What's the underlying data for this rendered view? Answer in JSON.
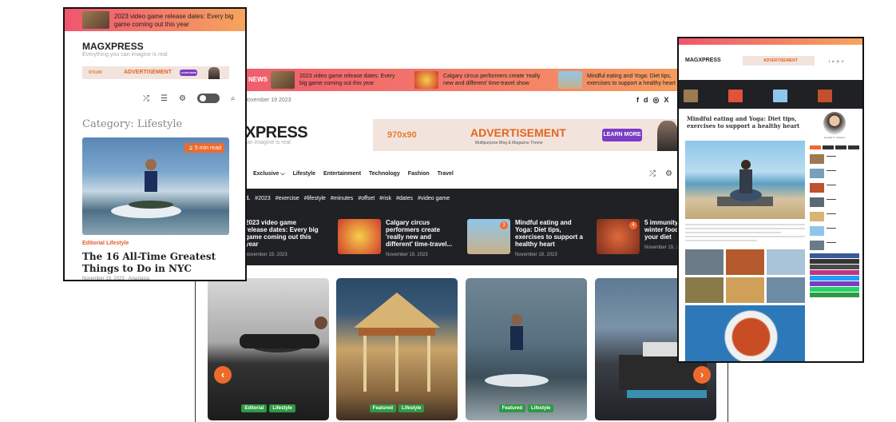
{
  "desktop": {
    "ticker_label": "NEWS",
    "ticker_items": [
      "2023 video game release dates: Every big game coming out this year",
      "Calgary circus performers create 'really new and different' time-travel show",
      "Mindful eating and Yoga: Diet tips, exercises to support a healthy heart"
    ],
    "date": "November 19 2023",
    "social": [
      "f",
      "d",
      "◎",
      "X"
    ],
    "logo": "XPRESS",
    "tagline": "an imagine is real",
    "ad": {
      "size": "970x90",
      "title": "ADVERTISEMENT",
      "subtitle": "Multipurpose Blog & Magazine Theme",
      "button": "LEARN MORE"
    },
    "nav": [
      "Exclusive ⌵",
      "Lifestyle",
      "Entertainment",
      "Technology",
      "Fashion",
      "Travel"
    ],
    "nav_icons": [
      "⤮",
      "⚙"
    ],
    "tags_prefix": "d.",
    "tags": [
      "#2023",
      "#exercise",
      "#lifestyle",
      "#minutes",
      "#offset",
      "#risk",
      "#dates",
      "#video game"
    ],
    "trending": [
      {
        "num": "",
        "title": "2023 video game release dates: Every big game coming out this year",
        "date": "November 19, 2023"
      },
      {
        "num": "",
        "title": "Calgary circus performers create 'really new and different' time-travel...",
        "date": "November 19, 2023"
      },
      {
        "num": "3",
        "title": "Mindful eating and Yoga: Diet tips, exercises to support a healthy heart",
        "date": "November 19, 2023"
      },
      {
        "num": "4",
        "title": "5 immunity boosting winter foods to add to your diet",
        "date": "November 19, 2023"
      }
    ],
    "slides": [
      {
        "badges": [
          "Editorial",
          "Lifestyle"
        ]
      },
      {
        "badges": [
          "Featured",
          "Lifestyle"
        ]
      },
      {
        "badges": [
          "Featured",
          "Lifestyle"
        ]
      },
      {
        "badges": []
      }
    ],
    "prev_arrow": "‹",
    "next_arrow": "›"
  },
  "mobile": {
    "ticker": "2023 video game release dates: Every big game coming out this year",
    "logo": "MAGXPRESS",
    "tagline": "Everything you can imagine is real",
    "ad": {
      "size": "970x90",
      "title": "ADVERTISEMENT",
      "button": "LEARN MORE"
    },
    "icons": [
      "⤮",
      "☰",
      "⚙",
      "⌕"
    ],
    "category": "Category: Lifestyle",
    "read_time": "⌛5 min read",
    "post_cats": "Editorial Lifestyle",
    "post_title": "The 16 All-Time Greatest Things to Do in NYC",
    "post_meta": "November 19, 2023 · Anastasia"
  },
  "article": {
    "logo": "MAGXPRESS",
    "ad_title": "ADVERTISEMENT",
    "title": "Mindful eating and Yoga: Diet tips, exercises to support a healthy heart",
    "author": "Jennifer S. Johnson"
  },
  "colors": {
    "accent": "#ee6a2c",
    "badge": "#2f9a44",
    "ticker_from": "#f0566e",
    "ticker_to": "#f6a55c",
    "dark": "#202124"
  }
}
